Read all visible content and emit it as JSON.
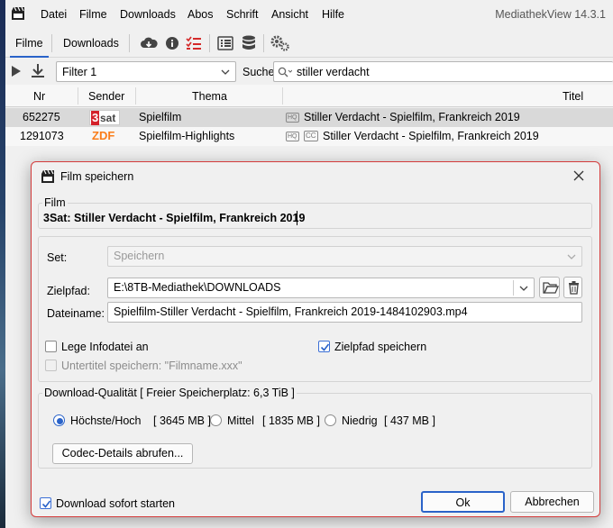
{
  "menu": {
    "items": [
      "Datei",
      "Filme",
      "Downloads",
      "Abos",
      "Schrift",
      "Ansicht",
      "Hilfe"
    ],
    "app_title": "MediathekView 14.3.1"
  },
  "tabs": {
    "filme": "Filme",
    "downloads": "Downloads"
  },
  "filter": {
    "selected": "Filter 1",
    "search_label": "Suche:",
    "search_value": "stiller verdacht"
  },
  "table": {
    "headers": {
      "nr": "Nr",
      "sender": "Sender",
      "thema": "Thema",
      "titel": "Titel"
    },
    "rows": [
      {
        "nr": "652275",
        "sender": "3sat",
        "thema": "Spielfilm",
        "titel": "Stiller Verdacht - Spielfilm, Frankreich 2019",
        "hq": "HQ",
        "cc": ""
      },
      {
        "nr": "1291073",
        "sender": "ZDF",
        "thema": "Spielfilm-Highlights",
        "titel": "Stiller Verdacht - Spielfilm, Frankreich 2019",
        "hq": "HQ",
        "cc": "CC"
      }
    ]
  },
  "dialog": {
    "title": "Film speichern",
    "film_legend": "Film",
    "film_value": "3Sat:  Stiller Verdacht - Spielfilm, Frankreich 2019",
    "set_label": "Set:",
    "set_value": "Speichern",
    "zielpfad_label": "Zielpfad:",
    "zielpfad_value": "E:\\8TB-Mediathek\\DOWNLOADS",
    "dateiname_label": "Dateiname:",
    "dateiname_value": "Spielfilm-Stiller Verdacht - Spielfilm, Frankreich 2019-1484102903.mp4",
    "infodatei_label": "Lege Infodatei an",
    "untertitel_label": "Untertitel speichern: \"Filmname.xxx\"",
    "zielpfad_speichern_label": "Zielpfad speichern",
    "quality_legend": "Download-Qualität [ Freier Speicherplatz: 6,3 TiB ]",
    "quality_options": [
      {
        "label": "Höchste/Hoch",
        "size": "[ 3645 MB ]",
        "selected": true
      },
      {
        "label": "Mittel",
        "size": "[ 1835 MB ]",
        "selected": false
      },
      {
        "label": "Niedrig",
        "size": "[ 437 MB ]",
        "selected": false
      }
    ],
    "codec_button": "Codec-Details abrufen...",
    "sofort_label": "Download sofort starten",
    "ok_button": "Ok",
    "cancel_button": "Abbrechen"
  },
  "colors": {
    "accent": "#2a63c9",
    "dialog_border": "#d43b3b",
    "selected_row": "#d9d9d9",
    "zdf": "#fa7d19",
    "sat_red": "#d4202a"
  }
}
